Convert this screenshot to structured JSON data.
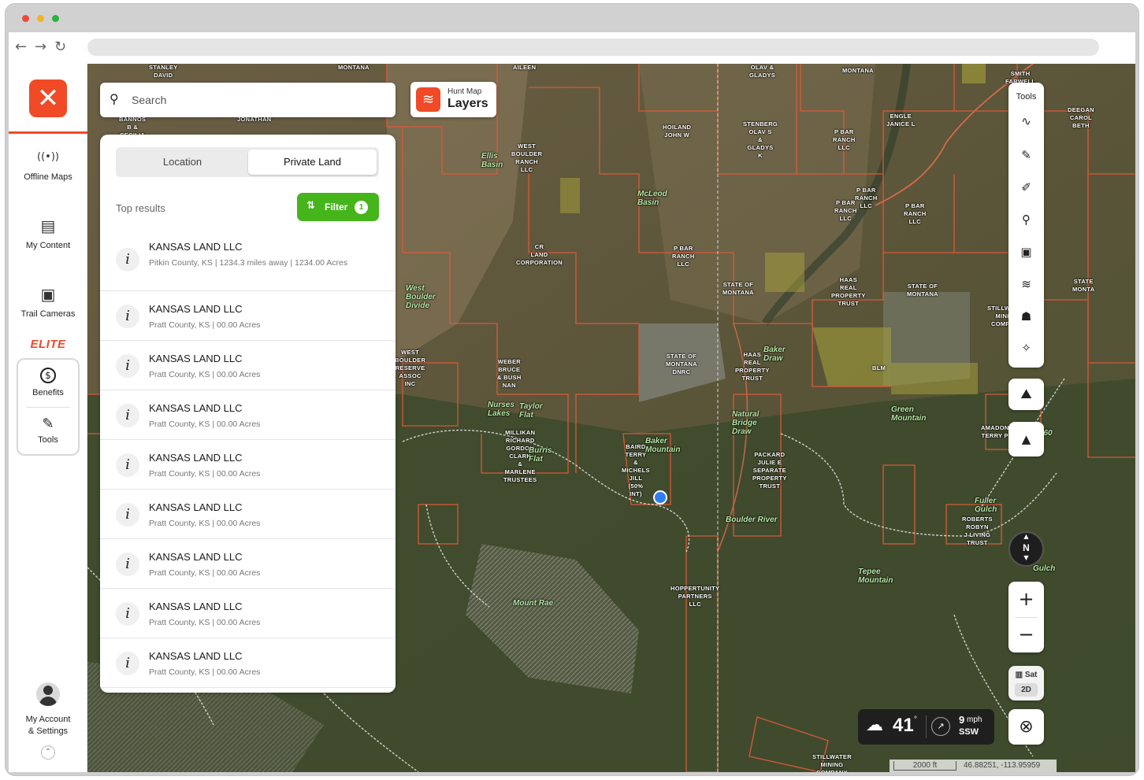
{
  "sidebar": {
    "logo_glyph": "✕",
    "items": [
      {
        "label": "Offline Maps",
        "icon": "offline-maps-icon",
        "glyph": "((•))"
      },
      {
        "label": "My Content",
        "icon": "folder-icon",
        "glyph": "▤"
      },
      {
        "label": "Trail Cameras",
        "icon": "trail-camera-icon",
        "glyph": "▣"
      }
    ],
    "elite_label": "ELITE",
    "elite_items": [
      {
        "label": "Benefits",
        "icon": "dollar-circle-icon",
        "glyph": "$"
      },
      {
        "label": "Tools",
        "icon": "tools-icon",
        "glyph": "✎"
      }
    ],
    "account_line1": "My Account",
    "account_line2": "& Settings"
  },
  "search": {
    "placeholder": "Search"
  },
  "layers": {
    "subtitle": "Hunt Map",
    "title": "Layers"
  },
  "panel": {
    "tabs": [
      "Location",
      "Private Land"
    ],
    "active_tab": "Private Land",
    "top_results_label": "Top results",
    "filter_label": "Filter",
    "filter_count": "1",
    "results": [
      {
        "name": "KANSAS LAND LLC",
        "meta": "Pitkin County, KS  |  1234.3 miles away  |  1234.00 Acres"
      },
      {
        "name": "KANSAS LAND LLC",
        "meta": "Pratt County, KS  |  00.00 Acres"
      },
      {
        "name": "KANSAS LAND LLC",
        "meta": "Pratt County, KS  |  00.00 Acres"
      },
      {
        "name": "KANSAS LAND LLC",
        "meta": "Pratt County, KS  |  00.00 Acres"
      },
      {
        "name": "KANSAS LAND LLC",
        "meta": "Pratt County, KS  |  00.00 Acres"
      },
      {
        "name": "KANSAS LAND LLC",
        "meta": "Pratt County, KS  |  00.00 Acres"
      },
      {
        "name": "KANSAS LAND LLC",
        "meta": "Pratt County, KS  |  00.00 Acres"
      },
      {
        "name": "KANSAS LAND LLC",
        "meta": "Pratt County, KS  |  00.00 Acres"
      },
      {
        "name": "KANSAS LAND LLC",
        "meta": "Pratt County, KS  |  00.00 Acres"
      }
    ]
  },
  "tools_panel": {
    "title": "Tools",
    "tools": [
      {
        "icon": "path-icon",
        "glyph": "∿"
      },
      {
        "icon": "pen-icon",
        "glyph": "✎"
      },
      {
        "icon": "eraser-pen-icon",
        "glyph": "✐"
      },
      {
        "icon": "pin-icon",
        "glyph": "⚲"
      },
      {
        "icon": "trail-camera-icon",
        "glyph": "▣"
      },
      {
        "icon": "wind-icon",
        "glyph": "≋"
      },
      {
        "icon": "people-icon",
        "glyph": "☗"
      },
      {
        "icon": "satellite-icon",
        "glyph": "✧"
      }
    ]
  },
  "map_controls": {
    "terrain_glyph": "⛰",
    "mountain_glyph": "▲",
    "compass_label": "N",
    "zoom_in": "+",
    "zoom_out": "−",
    "basemap_label": "Sat",
    "view_mode": "2D",
    "locate_glyph": "⊗"
  },
  "weather": {
    "temperature": "41",
    "degree": "°",
    "wind_speed": "9",
    "wind_unit": "mph",
    "wind_direction": "SSW"
  },
  "scale": {
    "distance": "2000 ft",
    "coordinates": "46.88251, -113.95959"
  },
  "map_labels": [
    "STANLEY\nDAVID",
    "MONTANA",
    "AILEEN",
    "OLAV &\nGLADYS",
    "MONTANA",
    "SMITH\nFARWELL",
    "BANNOS\nB &\nCECILIA",
    "JONATHAN",
    "DEEGAN\nCAROL\nBETH",
    "WEST\nBOULDER\nRANCH\nLLC",
    "HOILAND\nJOHN W",
    "STENBERG\nOLAV S\n&\nGLADYS\nK",
    "P BAR\nRANCH\nLLC",
    "ENGLE\nJANICE L",
    "CR\nLAND\nCORPORATION",
    "P BAR\nRANCH\nLLC",
    "P BAR\nRANCH\nLLC",
    "P BAR\nRANCH\nLLC",
    "P BAR\nRANCH\nLLC",
    "STATE OF\nMONTANA",
    "HAAS\nREAL\nPROPERTY\nTRUST",
    "STATE OF\nMONTANA",
    "STATE\nMONTA",
    "STILLWATER\nMINING\nCOMPANY",
    "WEST\nBOULDER\nRESERVE\nASSOC\nINC",
    "WEBER\nBRUCE\n& BUSH\nNAN",
    "STATE OF\nMONTANA\nDNRC",
    "HAAS\nREAL\nPROPERTY\nTRUST",
    "BLM",
    "MILLIKAN\nRICHARD\nGORDON\nCLARK\n&\nMARLENE\nTRUSTEES",
    "BAIRD\nTERRY\n&\nMICHELS\nJILL\n(50%\nINT)",
    "PACKARD\nJULIE E\nSEPARATE\nPROPERTY\nTRUST",
    "AMADON\nTERRY P",
    "ROBERTS\nROBYN\nJ LIVING\nTRUST",
    "HOPPERTUNITY\nPARTNERS\nLLC",
    "STILLWATER\nMINING\nCOMPANY"
  ],
  "geo_labels": [
    "Ellis\nBasin",
    "McLeod\nBasin",
    "West\nBoulder\nDivide",
    "Taylor\nFlat",
    "Nurses\nLakes",
    "Burris\nFlat",
    "Baker\nMountain",
    "Baker\nDraw",
    "Natural\nBridge\nDraw",
    "Green\nMountain",
    "Boulder River",
    "Tepee\nMountain",
    "Mount Rae",
    "Fuller\nGulch",
    "Gulch",
    "560"
  ]
}
